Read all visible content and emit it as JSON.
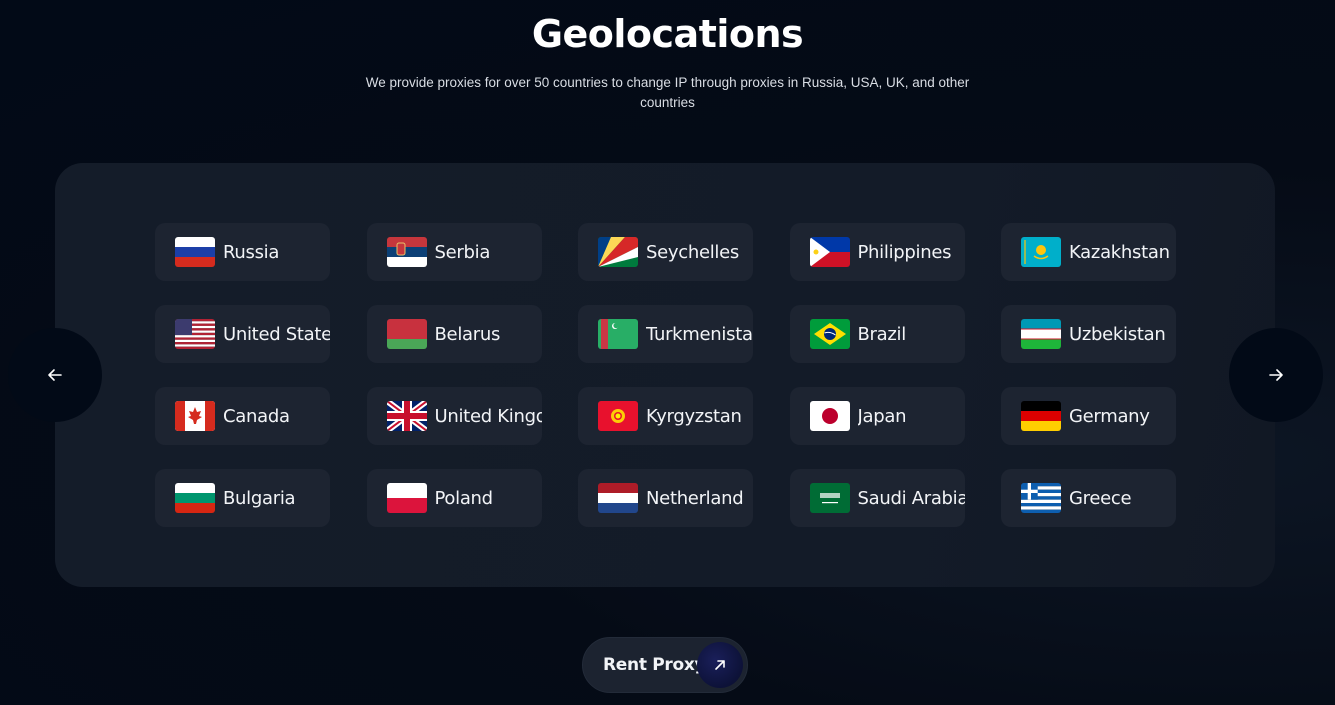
{
  "header": {
    "title": "Geolocations",
    "subtitle": "We provide proxies for over 50 countries to change IP through proxies in Russia, USA, UK, and other countries"
  },
  "carousel": {
    "prev_icon": "arrow-left-icon",
    "next_icon": "arrow-right-icon",
    "countries": [
      {
        "name": "Russia",
        "flag": "ru"
      },
      {
        "name": "Serbia",
        "flag": "rs"
      },
      {
        "name": "Seychelles",
        "flag": "sc"
      },
      {
        "name": "Philippines",
        "flag": "ph"
      },
      {
        "name": "Kazakhstan",
        "flag": "kz"
      },
      {
        "name": "United States",
        "flag": "us"
      },
      {
        "name": "Belarus",
        "flag": "by"
      },
      {
        "name": "Turkmenistan",
        "flag": "tm"
      },
      {
        "name": "Brazil",
        "flag": "br"
      },
      {
        "name": "Uzbekistan",
        "flag": "uz"
      },
      {
        "name": "Canada",
        "flag": "ca"
      },
      {
        "name": "United Kingdom",
        "flag": "gb"
      },
      {
        "name": "Kyrgyzstan",
        "flag": "kg"
      },
      {
        "name": "Japan",
        "flag": "jp"
      },
      {
        "name": "Germany",
        "flag": "de"
      },
      {
        "name": "Bulgaria",
        "flag": "bg"
      },
      {
        "name": "Poland",
        "flag": "pl"
      },
      {
        "name": "Netherland",
        "flag": "nl"
      },
      {
        "name": "Saudi Arabia",
        "flag": "sa"
      },
      {
        "name": "Greece",
        "flag": "gr"
      }
    ]
  },
  "cta": {
    "label": "Rent Proxy",
    "icon": "arrow-up-right-icon"
  },
  "colors": {
    "background": "#030b18",
    "panel": "#141c29",
    "card": "#1d2431",
    "cta_icon": "#141a4a"
  }
}
